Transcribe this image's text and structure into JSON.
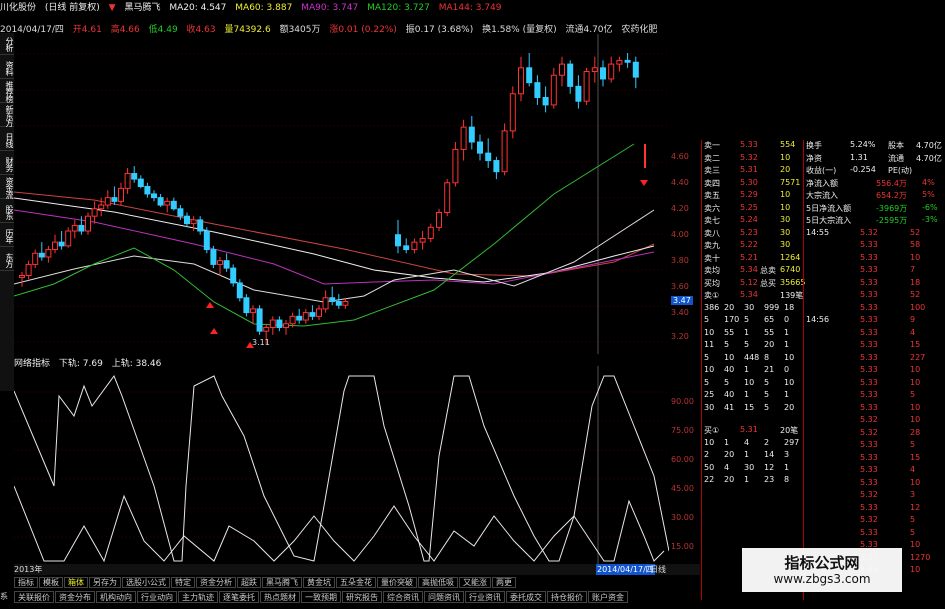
{
  "title_bar": {
    "stock": "川化股份",
    "period": "(日线 前复权)",
    "flag": "黑马腾飞",
    "ma": [
      "MA20: 4.547",
      "MA60: 3.887",
      "MA90: 3.747",
      "MA120: 3.727",
      "MA144: 3.749"
    ]
  },
  "info_bar": {
    "date": "2014/04/17/四",
    "open": "开4.61",
    "high": "高4.66",
    "low": "低4.49",
    "close": "收4.63",
    "volume": "量74392.6",
    "amount": "额3405万",
    "change": "涨0.01 (0.22%)",
    "amplitude": "振0.17 (3.68%)",
    "turnover": "换1.58% (量复权)",
    "float": "流通4.70亿",
    "sector": "农药化肥"
  },
  "left_tabs": [
    "分析",
    "资料",
    "推荐榜",
    "新东方",
    "日线",
    "财务",
    "资金流",
    "股东",
    "历年",
    "东方"
  ],
  "price_axis": [
    "4.60",
    "4.40",
    "4.20",
    "4.00",
    "3.80",
    "3.60",
    "3.47",
    "3.40",
    "3.20"
  ],
  "indicator": {
    "name": "网络指标",
    "down": "下轨: 7.69",
    "up": "上轨: 38.46"
  },
  "ind_axis": [
    "90.00",
    "75.00",
    "60.00",
    "45.00",
    "30.00",
    "15.00"
  ],
  "date_bar": {
    "left": "2013年",
    "right": "2014/04/17/四",
    "btn": "日线"
  },
  "tabs1": [
    "指标",
    "模板",
    "箱体",
    "另存为",
    "选股小公式",
    "特定",
    "资金分析",
    "超跌",
    "黑马腾飞",
    "黄金坑",
    "五朵金花",
    "量价突破",
    "高抛低吸",
    "又能涨",
    "两更"
  ],
  "tabs2": [
    "关联报价",
    "资金分布",
    "机构动向",
    "行业动向",
    "主力轨迹",
    "逐笔委托",
    "热点题材",
    "一致预期",
    "研究报告",
    "综合资讯",
    "问题资讯",
    "行业资讯",
    "委托成交",
    "持仓报价",
    "账户资金"
  ],
  "sys": "系",
  "order_book": {
    "sells": [
      {
        "label": "卖一",
        "price": "5.33",
        "vol": "554"
      },
      {
        "label": "卖二",
        "price": "5.32",
        "vol": "10"
      },
      {
        "label": "卖三",
        "price": "5.31",
        "vol": "20"
      },
      {
        "label": "卖四",
        "price": "5.30",
        "vol": "7571"
      },
      {
        "label": "卖五",
        "price": "5.29",
        "vol": "10"
      },
      {
        "label": "卖六",
        "price": "5.25",
        "vol": "10"
      },
      {
        "label": "卖七",
        "price": "5.24",
        "vol": "30"
      },
      {
        "label": "卖八",
        "price": "5.23",
        "vol": "30"
      },
      {
        "label": "卖九",
        "price": "5.22",
        "vol": "30"
      },
      {
        "label": "卖十",
        "price": "5.21",
        "vol": "1264"
      }
    ],
    "summary": [
      {
        "label": "卖均",
        "price": "5.34",
        "tag": "总卖",
        "vol": "6740"
      },
      {
        "label": "买均",
        "price": "5.12",
        "tag": "总买",
        "vol": "35665"
      }
    ],
    "sell1": {
      "label": "卖①",
      "price": "5.34",
      "vol": "139笔"
    },
    "queue1": [
      [
        "386",
        "20",
        "30",
        "999",
        "18"
      ],
      [
        "5",
        "170",
        "5",
        "65",
        "0"
      ],
      [
        "10",
        "55",
        "1",
        "55",
        "1"
      ],
      [
        "11",
        "5",
        "5",
        "20",
        "1"
      ],
      [
        "5",
        "10",
        "448",
        "8",
        "10"
      ],
      [
        "10",
        "40",
        "1",
        "21",
        "0"
      ],
      [
        "5",
        "5",
        "10",
        "5",
        "10"
      ],
      [
        "25",
        "40",
        "1",
        "5",
        "1"
      ],
      [
        "30",
        "41",
        "15",
        "5",
        "20"
      ]
    ],
    "buy1": {
      "label": "买①",
      "price": "5.31",
      "vol": "20笔"
    },
    "queue2": [
      [
        "10",
        "1",
        "4",
        "2",
        "297"
      ],
      [
        "2",
        "20",
        "1",
        "14",
        "3"
      ],
      [
        "50",
        "4",
        "30",
        "12",
        "1"
      ],
      [
        "22",
        "20",
        "1",
        "23",
        "8"
      ]
    ]
  },
  "right_panel": {
    "rows1": [
      {
        "a": "换手",
        "b": "5.24%",
        "c": "股本",
        "d": "4.70亿"
      },
      {
        "a": "净资",
        "b": "1.31",
        "c": "流通",
        "d": "4.70亿"
      },
      {
        "a": "收益(一)",
        "b": "-0.254",
        "c": "PE(动)",
        "d": ""
      }
    ],
    "flows": [
      {
        "a": "净流入额",
        "b": "556.4万",
        "c": "4%"
      },
      {
        "a": "大宗流入",
        "b": "654.2万",
        "c": "5%"
      },
      {
        "a": "5日净流入额",
        "b": "-3969万",
        "c": "-6%"
      },
      {
        "a": "5日大宗流入",
        "b": "-2595万",
        "c": "-3%"
      }
    ],
    "ticks": [
      {
        "t": "14:55",
        "p": "5.32",
        "v": "52"
      },
      {
        "t": "",
        "p": "5.33",
        "v": "58"
      },
      {
        "t": "",
        "p": "5.33",
        "v": "10"
      },
      {
        "t": "",
        "p": "5.33",
        "v": "7"
      },
      {
        "t": "",
        "p": "5.33",
        "v": "18"
      },
      {
        "t": "",
        "p": "5.33",
        "v": "52"
      },
      {
        "t": "",
        "p": "5.33",
        "v": "100"
      },
      {
        "t": "14:56",
        "p": "5.33",
        "v": "9"
      },
      {
        "t": "",
        "p": "5.33",
        "v": "4"
      },
      {
        "t": "",
        "p": "5.33",
        "v": "15"
      },
      {
        "t": "",
        "p": "5.33",
        "v": "227"
      },
      {
        "t": "",
        "p": "5.33",
        "v": "10"
      },
      {
        "t": "",
        "p": "5.33",
        "v": "10"
      },
      {
        "t": "",
        "p": "5.33",
        "v": "5"
      },
      {
        "t": "",
        "p": "5.33",
        "v": "10"
      },
      {
        "t": "",
        "p": "5.32",
        "v": "10"
      },
      {
        "t": "",
        "p": "5.32",
        "v": "28"
      },
      {
        "t": "",
        "p": "5.33",
        "v": "5"
      },
      {
        "t": "",
        "p": "5.33",
        "v": "15"
      },
      {
        "t": "",
        "p": "5.33",
        "v": "4"
      },
      {
        "t": "",
        "p": "5.33",
        "v": "10"
      },
      {
        "t": "",
        "p": "5.32",
        "v": "3"
      },
      {
        "t": "",
        "p": "5.33",
        "v": "12"
      },
      {
        "t": "",
        "p": "5.32",
        "v": "5"
      },
      {
        "t": "",
        "p": "5.33",
        "v": "5"
      },
      {
        "t": "",
        "p": "5.33",
        "v": "10"
      },
      {
        "t": "",
        "p": "5.33",
        "v": "1270"
      },
      {
        "t": "",
        "p": "5.33",
        "v": "10"
      }
    ]
  },
  "watermark": {
    "title": "指标公式网",
    "url": "www.zbgs3.com"
  },
  "chart_data": {
    "type": "candlestick",
    "ylim": [
      3.1,
      4.75
    ],
    "low_label": "3.11",
    "candles": [
      [
        3.47,
        3.5,
        3.42,
        3.48
      ],
      [
        3.48,
        3.56,
        3.46,
        3.54
      ],
      [
        3.54,
        3.62,
        3.52,
        3.6
      ],
      [
        3.6,
        3.66,
        3.56,
        3.58
      ],
      [
        3.58,
        3.64,
        3.55,
        3.62
      ],
      [
        3.62,
        3.7,
        3.6,
        3.66
      ],
      [
        3.66,
        3.72,
        3.62,
        3.64
      ],
      [
        3.64,
        3.74,
        3.63,
        3.72
      ],
      [
        3.72,
        3.78,
        3.68,
        3.75
      ],
      [
        3.75,
        3.8,
        3.7,
        3.72
      ],
      [
        3.72,
        3.82,
        3.7,
        3.8
      ],
      [
        3.8,
        3.88,
        3.76,
        3.84
      ],
      [
        3.84,
        3.9,
        3.8,
        3.86
      ],
      [
        3.86,
        3.94,
        3.84,
        3.9
      ],
      [
        3.9,
        3.96,
        3.86,
        3.88
      ],
      [
        3.88,
        3.98,
        3.86,
        3.95
      ],
      [
        3.95,
        4.06,
        3.92,
        4.03
      ],
      [
        4.03,
        4.07,
        3.98,
        4.0
      ],
      [
        4.0,
        4.02,
        3.95,
        3.96
      ],
      [
        3.96,
        3.98,
        3.9,
        3.92
      ],
      [
        3.92,
        3.94,
        3.88,
        3.9
      ],
      [
        3.9,
        3.92,
        3.85,
        3.86
      ],
      [
        3.86,
        3.9,
        3.82,
        3.88
      ],
      [
        3.88,
        3.9,
        3.83,
        3.84
      ],
      [
        3.84,
        3.86,
        3.78,
        3.8
      ],
      [
        3.8,
        3.82,
        3.74,
        3.76
      ],
      [
        3.76,
        3.8,
        3.72,
        3.78
      ],
      [
        3.78,
        3.8,
        3.7,
        3.72
      ],
      [
        3.72,
        3.74,
        3.6,
        3.62
      ],
      [
        3.62,
        3.64,
        3.52,
        3.54
      ],
      [
        3.54,
        3.58,
        3.48,
        3.56
      ],
      [
        3.56,
        3.6,
        3.5,
        3.52
      ],
      [
        3.52,
        3.54,
        3.42,
        3.44
      ],
      [
        3.44,
        3.46,
        3.34,
        3.36
      ],
      [
        3.36,
        3.38,
        3.26,
        3.28
      ],
      [
        3.28,
        3.32,
        3.22,
        3.3
      ],
      [
        3.3,
        3.32,
        3.16,
        3.18
      ],
      [
        3.18,
        3.22,
        3.11,
        3.2
      ],
      [
        3.2,
        3.26,
        3.16,
        3.24
      ],
      [
        3.24,
        3.26,
        3.18,
        3.2
      ],
      [
        3.2,
        3.24,
        3.16,
        3.22
      ],
      [
        3.22,
        3.28,
        3.2,
        3.26
      ],
      [
        3.26,
        3.3,
        3.22,
        3.24
      ],
      [
        3.24,
        3.3,
        3.22,
        3.28
      ],
      [
        3.28,
        3.32,
        3.24,
        3.26
      ],
      [
        3.26,
        3.32,
        3.24,
        3.3
      ],
      [
        3.3,
        3.4,
        3.28,
        3.36
      ],
      [
        3.36,
        3.42,
        3.32,
        3.34
      ],
      [
        3.34,
        3.38,
        3.3,
        3.32
      ],
      [
        3.32,
        3.36,
        3.3,
        3.34
      ]
    ],
    "candles2": [
      [
        3.7,
        3.78,
        3.6,
        3.64
      ],
      [
        3.64,
        3.68,
        3.6,
        3.62
      ],
      [
        3.62,
        3.68,
        3.6,
        3.66
      ],
      [
        3.66,
        3.72,
        3.62,
        3.68
      ],
      [
        3.68,
        3.76,
        3.66,
        3.74
      ],
      [
        3.74,
        3.84,
        3.72,
        3.82
      ],
      [
        3.82,
        4.0,
        3.8,
        3.98
      ],
      [
        3.98,
        4.2,
        3.96,
        4.16
      ],
      [
        4.16,
        4.32,
        4.1,
        4.28
      ],
      [
        4.28,
        4.34,
        4.16,
        4.2
      ],
      [
        4.2,
        4.24,
        4.1,
        4.14
      ],
      [
        4.14,
        4.22,
        4.06,
        4.1
      ],
      [
        4.1,
        4.12,
        4.0,
        4.04
      ],
      [
        4.04,
        4.3,
        4.02,
        4.26
      ],
      [
        4.26,
        4.5,
        4.22,
        4.46
      ],
      [
        4.46,
        4.66,
        4.42,
        4.6
      ],
      [
        4.6,
        4.68,
        4.5,
        4.52
      ],
      [
        4.52,
        4.56,
        4.4,
        4.44
      ],
      [
        4.44,
        4.5,
        4.36,
        4.4
      ],
      [
        4.4,
        4.6,
        4.38,
        4.56
      ],
      [
        4.56,
        4.66,
        4.5,
        4.62
      ],
      [
        4.62,
        4.64,
        4.46,
        4.5
      ],
      [
        4.5,
        4.56,
        4.38,
        4.42
      ],
      [
        4.42,
        4.6,
        4.4,
        4.58
      ],
      [
        4.58,
        4.66,
        4.52,
        4.6
      ],
      [
        4.6,
        4.64,
        4.5,
        4.54
      ],
      [
        4.54,
        4.66,
        4.52,
        4.62
      ],
      [
        4.62,
        4.66,
        4.58,
        4.64
      ],
      [
        4.64,
        4.68,
        4.6,
        4.63
      ],
      [
        4.63,
        4.66,
        4.49,
        4.55
      ]
    ]
  }
}
